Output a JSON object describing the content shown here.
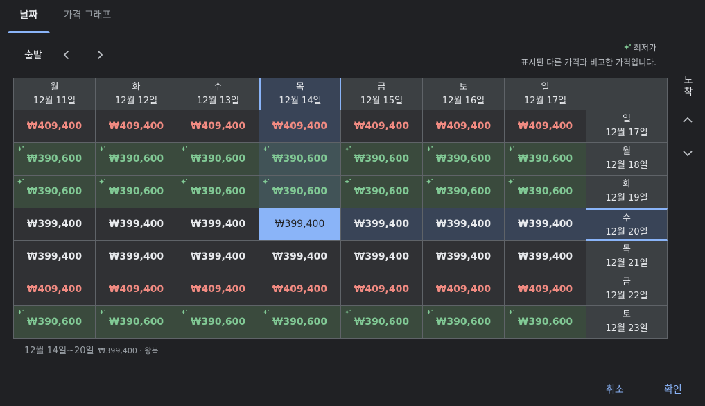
{
  "tabs": [
    {
      "label": "날짜",
      "active": true
    },
    {
      "label": "가격 그래프",
      "active": false
    }
  ],
  "departure": {
    "label": "출발"
  },
  "legend": {
    "title": "최저가",
    "description": "표시된 다른 가격과 비교한 가격입니다."
  },
  "arrival": {
    "label": "도착"
  },
  "columns": [
    {
      "day": "월",
      "date": "12월 11일"
    },
    {
      "day": "화",
      "date": "12월 12일"
    },
    {
      "day": "수",
      "date": "12월 13일"
    },
    {
      "day": "목",
      "date": "12월 14일"
    },
    {
      "day": "금",
      "date": "12월 15일"
    },
    {
      "day": "토",
      "date": "12월 16일"
    },
    {
      "day": "일",
      "date": "12월 17일"
    }
  ],
  "rows": [
    {
      "day": "일",
      "date": "12월 17일",
      "tier": "high",
      "prices": [
        "₩409,400",
        "₩409,400",
        "₩409,400",
        "₩409,400",
        "₩409,400",
        "₩409,400",
        "₩409,400"
      ]
    },
    {
      "day": "월",
      "date": "12월 18일",
      "tier": "low",
      "prices": [
        "₩390,600",
        "₩390,600",
        "₩390,600",
        "₩390,600",
        "₩390,600",
        "₩390,600",
        "₩390,600"
      ]
    },
    {
      "day": "화",
      "date": "12월 19일",
      "tier": "low",
      "prices": [
        "₩390,600",
        "₩390,600",
        "₩390,600",
        "₩390,600",
        "₩390,600",
        "₩390,600",
        "₩390,600"
      ]
    },
    {
      "day": "수",
      "date": "12월 20일",
      "tier": "mid",
      "prices": [
        "₩399,400",
        "₩399,400",
        "₩399,400",
        "₩399,400",
        "₩399,400",
        "₩399,400",
        "₩399,400"
      ]
    },
    {
      "day": "목",
      "date": "12월 21일",
      "tier": "mid",
      "prices": [
        "₩399,400",
        "₩399,400",
        "₩399,400",
        "₩399,400",
        "₩399,400",
        "₩399,400",
        "₩399,400"
      ]
    },
    {
      "day": "금",
      "date": "12월 22일",
      "tier": "high",
      "prices": [
        "₩409,400",
        "₩409,400",
        "₩409,400",
        "₩409,400",
        "₩409,400",
        "₩409,400",
        "₩409,400"
      ]
    },
    {
      "day": "토",
      "date": "12월 23일",
      "tier": "low",
      "prices": [
        "₩390,600",
        "₩390,600",
        "₩390,600",
        "₩390,600",
        "₩390,600",
        "₩390,600",
        "₩390,600"
      ]
    }
  ],
  "selection": {
    "column": 3,
    "row": 3
  },
  "summary": {
    "dates": "12월 14일~20일",
    "price": "₩399,400 · 왕복"
  },
  "buttons": {
    "cancel": "취소",
    "ok": "확인"
  },
  "colors": {
    "accent": "#8ab4f8",
    "low": "#81c995",
    "high": "#f28b82"
  }
}
